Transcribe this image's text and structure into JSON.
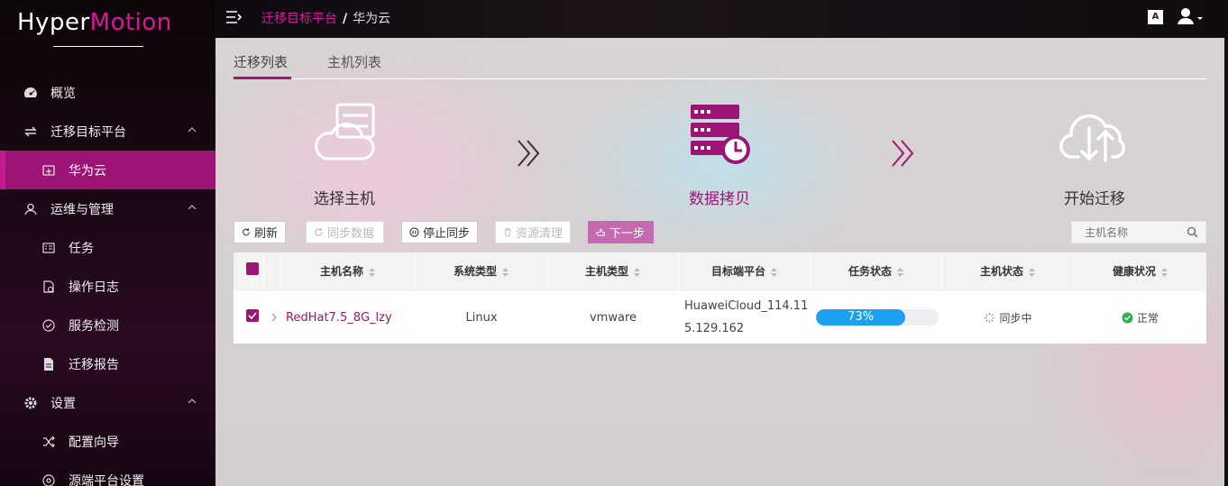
{
  "app": {
    "logo_part1": "Hyper",
    "logo_part2": "Motion"
  },
  "sidebar": {
    "items": [
      {
        "label": "概览",
        "icon": "dashboard-icon"
      },
      {
        "label": "迁移目标平台",
        "icon": "transfer-icon",
        "expanded": true
      },
      {
        "label": "华为云",
        "icon": "cloud-box-icon",
        "active": true
      },
      {
        "label": "运维与管理",
        "icon": "user-icon",
        "expanded": true
      },
      {
        "label": "任务",
        "icon": "task-icon"
      },
      {
        "label": "操作日志",
        "icon": "log-icon"
      },
      {
        "label": "服务检测",
        "icon": "check-icon"
      },
      {
        "label": "迁移报告",
        "icon": "report-icon"
      },
      {
        "label": "设置",
        "icon": "gear-icon",
        "expanded": true
      },
      {
        "label": "配置向导",
        "icon": "shuffle-icon"
      },
      {
        "label": "源端平台设置",
        "icon": "target-icon"
      }
    ]
  },
  "header": {
    "breadcrumb_parent": "迁移目标平台",
    "breadcrumb_sep": "/",
    "breadcrumb_current": "华为云",
    "lang_label": "A"
  },
  "tabs": [
    {
      "label": "迁移列表",
      "active": true
    },
    {
      "label": "主机列表",
      "active": false
    }
  ],
  "steps": [
    {
      "label": "选择主机"
    },
    {
      "label": "数据拷贝",
      "active": true
    },
    {
      "label": "开始迁移"
    }
  ],
  "toolbar": {
    "refresh": "刷新",
    "sync": "同步数据",
    "stop_sync": "停止同步",
    "cleanup": "资源清理",
    "next": "下一步",
    "search_placeholder": "主机名称"
  },
  "table": {
    "columns": [
      "主机名称",
      "系统类型",
      "主机类型",
      "目标端平台",
      "任务状态",
      "主机状态",
      "健康状况"
    ],
    "rows": [
      {
        "host_name": "RedHat7.5_8G_lzy",
        "os_type": "Linux",
        "host_type": "vmware",
        "target_line1": "HuaweiCloud_114.11",
        "target_line2": "5.129.162",
        "progress": 73,
        "progress_text": "73%",
        "host_status": "同步中",
        "health": "正常"
      }
    ]
  },
  "colors": {
    "accent": "#9c1574",
    "brand_pink": "#d9179c",
    "progress_blue": "#1aa0ec",
    "health_green": "#2bb24c"
  }
}
